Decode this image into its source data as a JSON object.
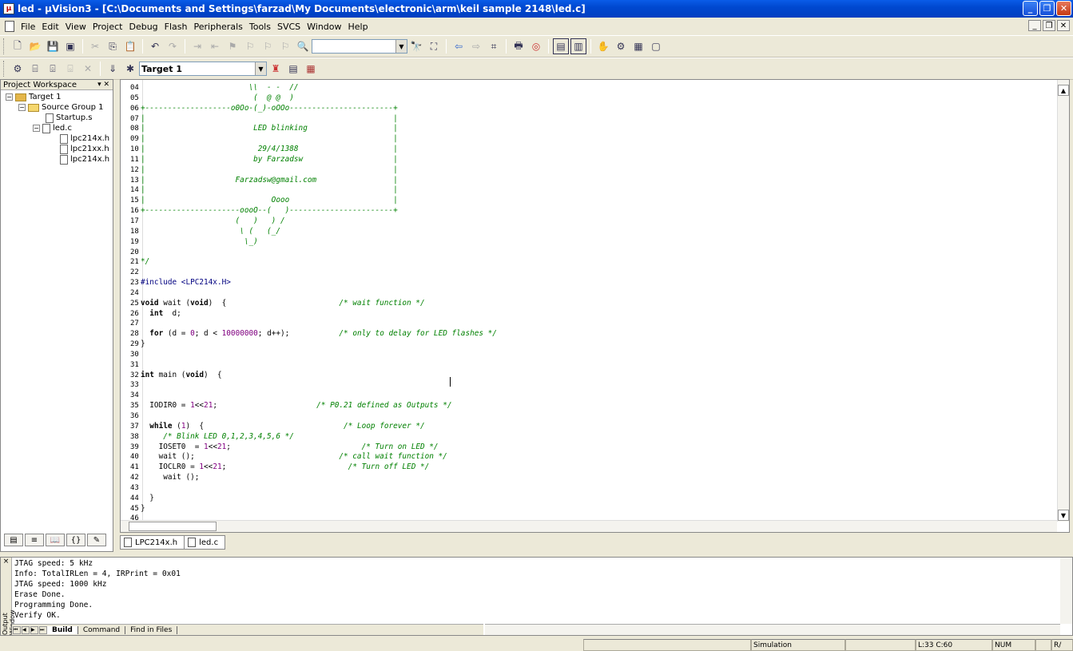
{
  "window": {
    "title": "led  - µVision3 - [C:\\Documents and Settings\\farzad\\My Documents\\electronic\\arm\\keil sample 2148\\led.c]",
    "app_icon": "uvision-icon",
    "controls": [
      "minimize",
      "restore",
      "close"
    ]
  },
  "menu": [
    "File",
    "Edit",
    "View",
    "Project",
    "Debug",
    "Flash",
    "Peripherals",
    "Tools",
    "SVCS",
    "Window",
    "Help"
  ],
  "toolbar": {
    "find_combo_value": "",
    "target_combo_value": "Target 1"
  },
  "project_workspace": {
    "title": "Project Workspace",
    "tree": [
      {
        "label": "Target 1",
        "level": 0,
        "kind": "target",
        "expanded": true
      },
      {
        "label": "Source Group 1",
        "level": 1,
        "kind": "folder",
        "expanded": true
      },
      {
        "label": "Startup.s",
        "level": 2,
        "kind": "file"
      },
      {
        "label": "led.c",
        "level": 2,
        "kind": "file",
        "expanded": true
      },
      {
        "label": "lpc214x.h",
        "level": 3,
        "kind": "header"
      },
      {
        "label": "lpc21xx.h",
        "level": 3,
        "kind": "header"
      },
      {
        "label": "lpc214x.h",
        "level": 3,
        "kind": "header"
      }
    ],
    "tabs": [
      "files-tab",
      "regs-tab",
      "books-tab",
      "functions-tab",
      "templates-tab"
    ]
  },
  "editor": {
    "lines": [
      {
        "n": "04",
        "t": "                        \\\\  - -  //",
        "c": "cm"
      },
      {
        "n": "05",
        "t": "                         (  @ @  )",
        "c": "cm"
      },
      {
        "n": "06",
        "t": "+-------------------o0Oo-(_)-oOOo-----------------------+",
        "c": "cm"
      },
      {
        "n": "07",
        "t": "|                                                       |",
        "c": "cm"
      },
      {
        "n": "08",
        "t": "|                        LED blinking                   |",
        "c": "cm"
      },
      {
        "n": "09",
        "t": "|                                                       |",
        "c": "cm"
      },
      {
        "n": "10",
        "t": "|                         29/4/1388                     |",
        "c": "cm"
      },
      {
        "n": "11",
        "t": "|                        by Farzadsw                    |",
        "c": "cm"
      },
      {
        "n": "12",
        "t": "|                                                       |",
        "c": "cm"
      },
      {
        "n": "13",
        "t": "|                    Farzadsw@gmail.com                 |",
        "c": "cm"
      },
      {
        "n": "14",
        "t": "|                                                       |",
        "c": "cm"
      },
      {
        "n": "15",
        "t": "|                            Oooo                       |",
        "c": "cm"
      },
      {
        "n": "16",
        "t": "+---------------------oooO--(   )-----------------------+",
        "c": "cm"
      },
      {
        "n": "17",
        "t": "                     (   )   ) /",
        "c": "cm"
      },
      {
        "n": "18",
        "t": "                      \\ (   (_/",
        "c": "cm"
      },
      {
        "n": "19",
        "t": "                       \\_)",
        "c": "cm"
      },
      {
        "n": "20",
        "t": "",
        "c": ""
      },
      {
        "n": "21",
        "t": "*/",
        "c": "cm"
      },
      {
        "n": "22",
        "t": "",
        "c": ""
      },
      {
        "n": "23",
        "t": "#include <LPC214x.H>",
        "c": "pp"
      },
      {
        "n": "24",
        "t": "",
        "c": ""
      },
      {
        "n": "25",
        "t": "void wait (void)  {                         /* wait function */",
        "c": "mix"
      },
      {
        "n": "26",
        "t": "  int  d;",
        "c": "mix"
      },
      {
        "n": "27",
        "t": "",
        "c": ""
      },
      {
        "n": "28",
        "t": "  for (d = 0; d < 10000000; d++);           /* only to delay for LED flashes */",
        "c": "mix"
      },
      {
        "n": "29",
        "t": "}",
        "c": ""
      },
      {
        "n": "30",
        "t": "",
        "c": ""
      },
      {
        "n": "31",
        "t": "",
        "c": ""
      },
      {
        "n": "32",
        "t": "int main (void)  {",
        "c": "mix"
      },
      {
        "n": "33",
        "t": "",
        "c": ""
      },
      {
        "n": "34",
        "t": "",
        "c": ""
      },
      {
        "n": "35",
        "t": "  IODIR0 = 1<<21;                      /* P0.21 defined as Outputs */",
        "c": "mix"
      },
      {
        "n": "36",
        "t": "",
        "c": ""
      },
      {
        "n": "37",
        "t": "  while (1)  {                               /* Loop forever */",
        "c": "mix"
      },
      {
        "n": "38",
        "t": "     /* Blink LED 0,1,2,3,4,5,6 */",
        "c": "cm"
      },
      {
        "n": "39",
        "t": "    IOSET0  = 1<<21;                             /* Turn on LED */",
        "c": "mix"
      },
      {
        "n": "40",
        "t": "    wait ();                                /* call wait function */",
        "c": "mix"
      },
      {
        "n": "41",
        "t": "    IOCLR0 = 1<<21;                           /* Turn off LED */",
        "c": "mix"
      },
      {
        "n": "42",
        "t": "     wait ();",
        "c": ""
      },
      {
        "n": "43",
        "t": "",
        "c": ""
      },
      {
        "n": "44",
        "t": "  }",
        "c": ""
      },
      {
        "n": "45",
        "t": "}",
        "c": ""
      },
      {
        "n": "46",
        "t": "",
        "c": ""
      }
    ],
    "tabs": [
      "LPC214x.h",
      "led.c"
    ]
  },
  "output": {
    "lines": [
      "JTAG speed: 5 kHz",
      "Info: TotalIRLen = 4, IRPrint = 0x01",
      "JTAG speed: 1000 kHz",
      "Erase Done.",
      "Programming Done.",
      "Verify OK."
    ],
    "side_label": "Output Window",
    "tabs": [
      "Build",
      "Command",
      "Find in Files"
    ]
  },
  "status": {
    "mode": "Simulation",
    "position": "L:33 C:60",
    "num": "NUM",
    "rw": "R/"
  },
  "colors": {
    "comment": "#008000",
    "keyword": "#000000",
    "number": "#800080",
    "preprocessor": "#000080"
  }
}
